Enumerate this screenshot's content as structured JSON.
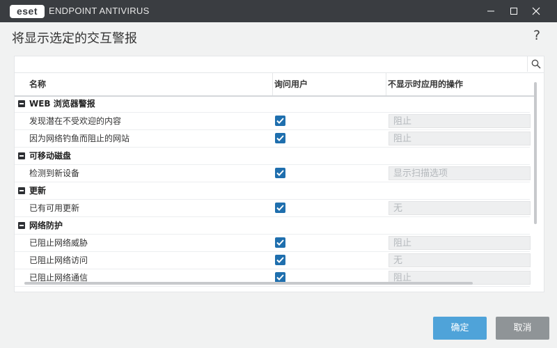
{
  "window": {
    "logo_text": "eset",
    "product_name": "ENDPOINT ANTIVIRUS"
  },
  "dialog": {
    "title": "将显示选定的交互警报",
    "help": "?"
  },
  "search": {
    "placeholder": "",
    "value": ""
  },
  "table": {
    "columns": [
      "名称",
      "询问用户",
      "不显示时应用的操作"
    ],
    "groups": [
      {
        "name": "WEB 浏览器警报",
        "items": [
          {
            "label": "发现潜在不受欢迎的内容",
            "ask_user": true,
            "action": "阻止"
          },
          {
            "label": "因为网络钓鱼而阻止的网站",
            "ask_user": true,
            "action": "阻止"
          }
        ]
      },
      {
        "name": "可移动磁盘",
        "items": [
          {
            "label": "检测到新设备",
            "ask_user": true,
            "action": "显示扫描选项"
          }
        ]
      },
      {
        "name": "更新",
        "items": [
          {
            "label": "已有可用更新",
            "ask_user": true,
            "action": "无"
          }
        ]
      },
      {
        "name": "网络防护",
        "items": [
          {
            "label": "已阻止网络威胁",
            "ask_user": true,
            "action": "阻止"
          },
          {
            "label": "已阻止网络访问",
            "ask_user": true,
            "action": "无"
          },
          {
            "label": "已阻止网络通信",
            "ask_user": true,
            "action": "阻止"
          }
        ]
      }
    ]
  },
  "buttons": {
    "ok": "确定",
    "cancel": "取消"
  },
  "colors": {
    "titlebar": "#3a3d41",
    "checkbox": "#1f6fae",
    "ok_button": "#4fa3d9",
    "cancel_button": "#8f9497"
  }
}
